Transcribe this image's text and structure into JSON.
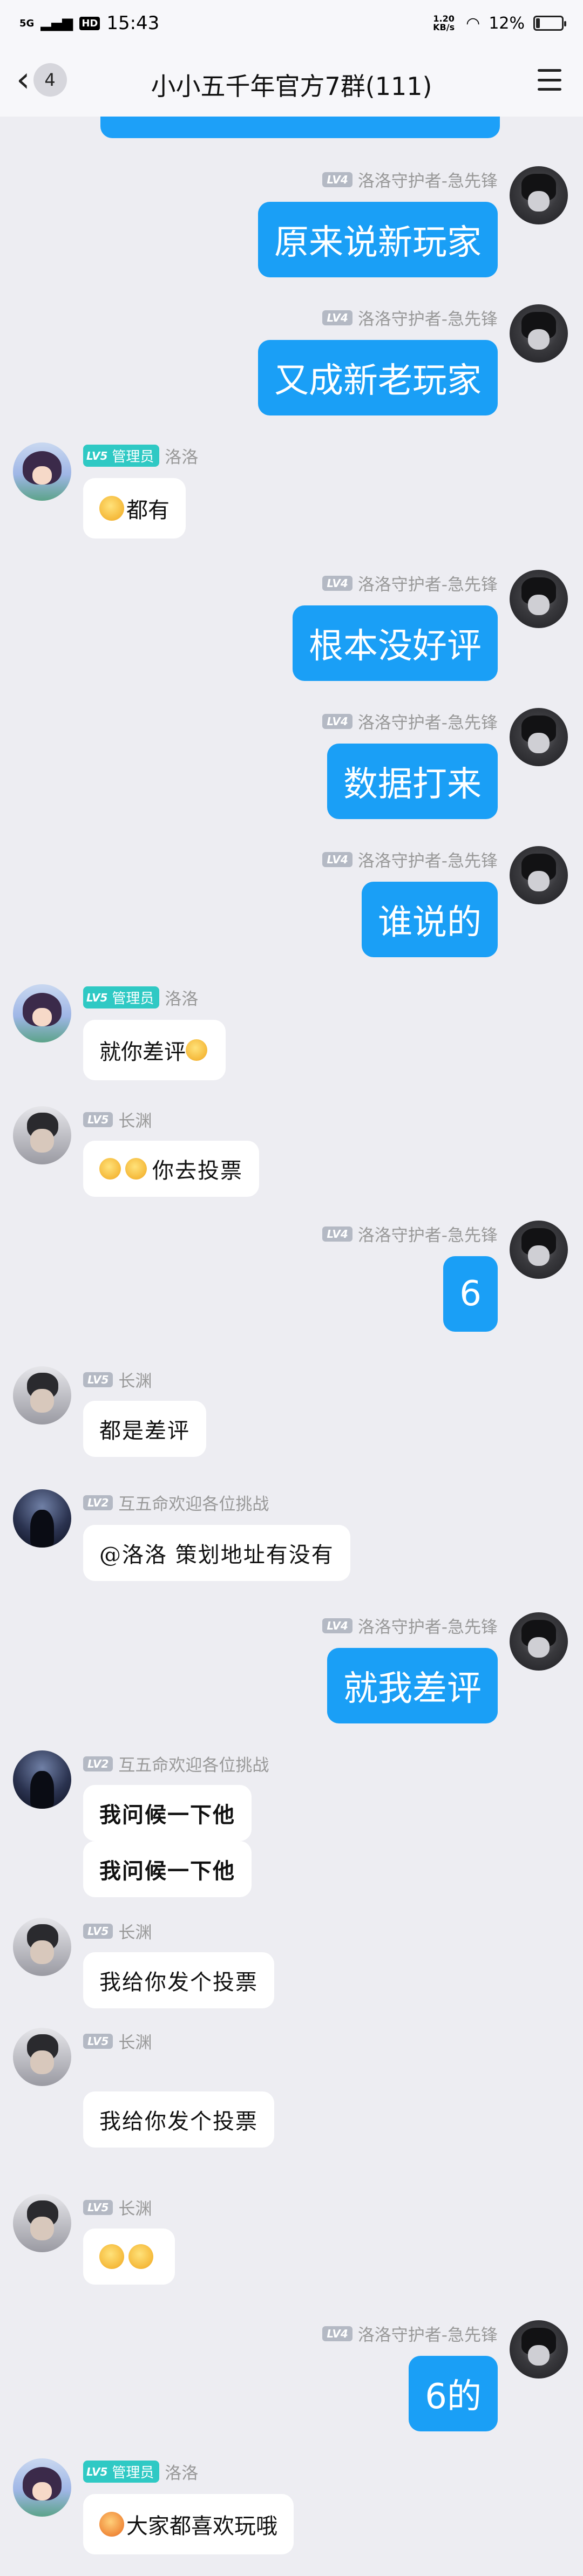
{
  "status": {
    "signal": "5G",
    "hd": "HD",
    "time": "15:43",
    "speed": "1.20 KB/s",
    "battery": "12%"
  },
  "header": {
    "back_count": "4",
    "title": "小小五千年官方7群(111)"
  },
  "messages": [
    {
      "side": "me",
      "level": "LV4",
      "name": "洛洛守护者-急先锋",
      "text": "原来说新玩家"
    },
    {
      "side": "me",
      "level": "LV4",
      "name": "洛洛守护者-急先锋",
      "text": "又成新老玩家"
    },
    {
      "side": "them",
      "level": "LV5",
      "role": "管理员",
      "name": "洛洛",
      "text": "都有"
    },
    {
      "side": "me",
      "level": "LV4",
      "name": "洛洛守护者-急先锋",
      "text": "根本没好评"
    },
    {
      "side": "me",
      "level": "LV4",
      "name": "洛洛守护者-急先锋",
      "text": "数据打来"
    },
    {
      "side": "me",
      "level": "LV4",
      "name": "洛洛守护者-急先锋",
      "text": "谁说的"
    },
    {
      "side": "them",
      "level": "LV5",
      "role": "管理员",
      "name": "洛洛",
      "text": "就你差评"
    },
    {
      "side": "them",
      "level": "LV5",
      "name": "长渊",
      "text": "你去投票"
    },
    {
      "side": "me",
      "level": "LV4",
      "name": "洛洛守护者-急先锋",
      "text": "6"
    },
    {
      "side": "them",
      "level": "LV5",
      "name": "长渊",
      "text": "都是差评"
    },
    {
      "side": "them",
      "level": "LV2",
      "name": "互五命欢迎各位挑战",
      "text": "@洛洛 策划地址有没有"
    },
    {
      "side": "me",
      "level": "LV4",
      "name": "洛洛守护者-急先锋",
      "text": "就我差评"
    },
    {
      "side": "them",
      "level": "LV2",
      "name": "互五命欢迎各位挑战",
      "text": "我问候一下他"
    },
    {
      "side": "them",
      "text": "我问候一下他"
    },
    {
      "side": "them",
      "level": "LV5",
      "name": "长渊",
      "text": "我给你发个投票"
    },
    {
      "side": "them",
      "level": "LV5",
      "name": "长渊",
      "text": "我给你发个投票"
    },
    {
      "side": "them",
      "level": "LV5",
      "name": "长渊",
      "text": ""
    },
    {
      "side": "me",
      "level": "LV4",
      "name": "洛洛守护者-急先锋",
      "text": "6的"
    },
    {
      "side": "them",
      "level": "LV5",
      "role": "管理员",
      "name": "洛洛",
      "text": "大家都喜欢玩哦"
    }
  ],
  "colors": {
    "me_bubble": "#1a9ff6",
    "admin_badge": "#2fc9c4",
    "level_badge": "#b4b9c4",
    "background": "#ededf2"
  }
}
